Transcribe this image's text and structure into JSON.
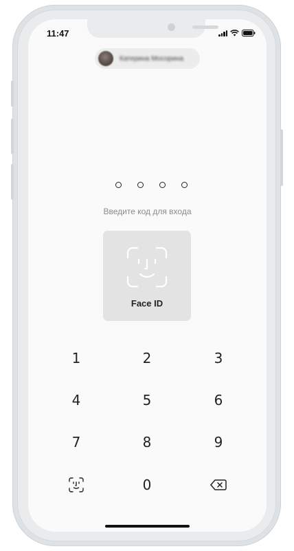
{
  "status_bar": {
    "time": "11:47"
  },
  "user": {
    "name": "Катерина Мосорина"
  },
  "pin": {
    "length": 4,
    "prompt": "Введите код для входа"
  },
  "face_id": {
    "label": "Face ID"
  },
  "keypad": {
    "keys": [
      "1",
      "2",
      "3",
      "4",
      "5",
      "6",
      "7",
      "8",
      "9",
      "0"
    ],
    "face_id_icon": "face-id-icon",
    "delete_icon": "backspace-icon"
  }
}
